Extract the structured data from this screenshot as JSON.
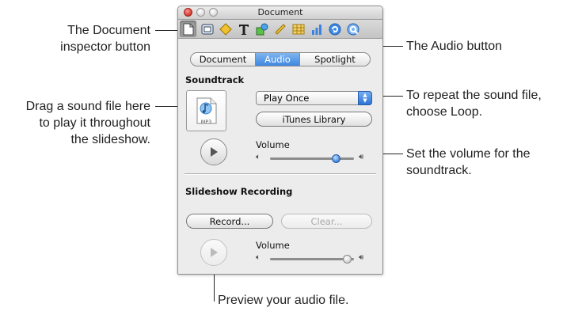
{
  "window": {
    "title": "Document"
  },
  "toolbar": {
    "icons": [
      "document-icon",
      "layout-icon",
      "transition-icon",
      "text-icon",
      "graphic-icon",
      "metrics-icon",
      "table-icon",
      "chart-icon",
      "hyperlink-icon",
      "quicktime-icon"
    ],
    "selected": "document-icon"
  },
  "tabs": [
    {
      "label": "Document"
    },
    {
      "label": "Audio",
      "selected": true
    },
    {
      "label": "Spotlight"
    }
  ],
  "soundtrack": {
    "heading": "Soundtrack",
    "file_label": "MP3",
    "play_mode": "Play Once",
    "itunes_button": "iTunes Library",
    "volume_label": "Volume",
    "volume_level": 0.82
  },
  "recording": {
    "heading": "Slideshow Recording",
    "record_button": "Record...",
    "clear_button": "Clear...",
    "volume_label": "Volume",
    "volume_level": 0.97
  },
  "callouts": {
    "document_inspector": [
      "The Document",
      "inspector button"
    ],
    "audio_button": "The Audio button",
    "drag_sound": [
      "Drag a sound file here",
      "to play it throughout",
      "the slideshow."
    ],
    "repeat": [
      "To repeat the sound file,",
      "choose Loop."
    ],
    "volume": [
      "Set the volume for the",
      "soundtrack."
    ],
    "preview": "Preview your audio file."
  },
  "colors": {
    "accent": "#3f87e0",
    "window_bg": "#ececec"
  }
}
